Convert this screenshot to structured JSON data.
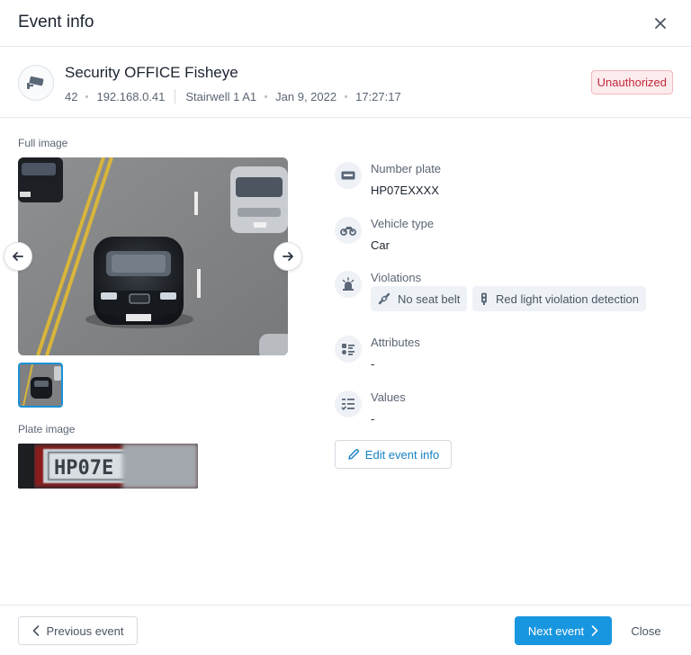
{
  "dialog": {
    "title": "Event info",
    "close_icon": "close-icon"
  },
  "camera": {
    "name": "Security OFFICE Fisheye",
    "id": "42",
    "ip": "192.168.0.41",
    "location": "Stairwell 1 A1",
    "date": "Jan 9, 2022",
    "time": "17:27:17",
    "status_badge": "Unauthorized",
    "status_color": "#c4283a",
    "icon": "security-camera-icon"
  },
  "images": {
    "full_label": "Full image",
    "plate_label": "Plate image",
    "plate_text": "HP07E",
    "prev_icon": "arrow-left-icon",
    "next_icon": "arrow-right-icon",
    "selected_thumbnail": 1,
    "thumbnail_count": 1
  },
  "details": {
    "number_plate": {
      "label": "Number plate",
      "value": "HP07EXXXX",
      "icon": "license-plate-icon"
    },
    "vehicle_type": {
      "label": "Vehicle type",
      "value": "Car",
      "icon": "motorbike-icon"
    },
    "violations": {
      "label": "Violations",
      "icon": "siren-icon",
      "items": [
        {
          "label": "No seat belt",
          "icon": "seat-belt-icon"
        },
        {
          "label": "Red light violation detection",
          "icon": "traffic-light-icon"
        }
      ]
    },
    "attributes": {
      "label": "Attributes",
      "value": "-",
      "icon": "attributes-list-icon"
    },
    "values": {
      "label": "Values",
      "value": "-",
      "icon": "checklist-icon"
    }
  },
  "actions": {
    "edit_label": "Edit event info",
    "prev_label": "Previous event",
    "next_label": "Next event",
    "close_label": "Close"
  },
  "colors": {
    "accent": "#1996e0",
    "link": "#1682c4",
    "danger": "#c4283a"
  }
}
